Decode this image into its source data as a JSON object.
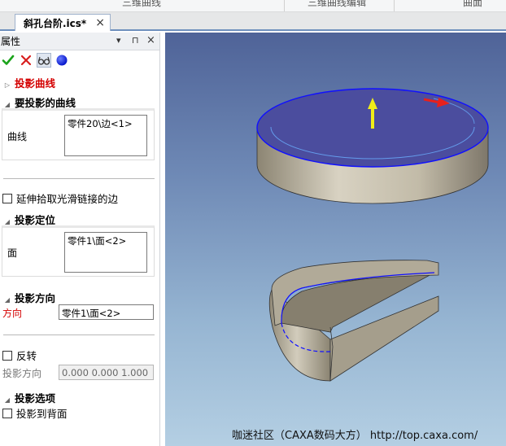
{
  "ribbon": {
    "groups": [
      "三维曲线",
      "三维曲线编辑",
      "曲面"
    ]
  },
  "doc_tab": {
    "title": "斜孔台阶.ics*",
    "close_glyph": "×"
  },
  "panel": {
    "title": "属性",
    "header_buttons": {
      "dropdown": "▾",
      "pin": "⊓",
      "close": "×"
    },
    "toolbar": {
      "ok_icon": "check-icon",
      "cancel_icon": "cross-icon",
      "preview_icon": "glasses-icon",
      "pick_icon": "blue-ball-icon"
    },
    "projection_curve": {
      "title": "投影曲线",
      "color": "#d40000"
    },
    "curves_section": {
      "title": "要投影的曲线",
      "field_label": "曲线",
      "value": "零件20\\边<1>"
    },
    "extend_checkbox": {
      "label": "延伸拾取光滑链接的边",
      "checked": false
    },
    "position_section": {
      "title": "投影定位",
      "field_label": "面",
      "value": "零件1\\面<2>"
    },
    "direction_section": {
      "title": "投影方向",
      "field_label": "方向",
      "value": "零件1\\面<2>"
    },
    "reverse_checkbox": {
      "label": "反转",
      "checked": false
    },
    "projection_direction": {
      "label": "投影方向",
      "value": "0.000  0.000  1.000"
    },
    "options_section": {
      "title": "投影选项"
    },
    "backface_checkbox": {
      "label": "投影到背面",
      "checked": false
    }
  },
  "viewport": {
    "watermark": "咖迷社区（CAXA数码大方） http://top.caxa.com/",
    "colors": {
      "background_top": "#4f6398",
      "background_bottom": "#b4cfe3",
      "disc_top": "#4b4d9e",
      "part_side": "#b5ad9a",
      "edge_highlight": "#1010ff",
      "arrow_yellow": "#f0ee18",
      "arrow_red": "#e8201c"
    }
  }
}
